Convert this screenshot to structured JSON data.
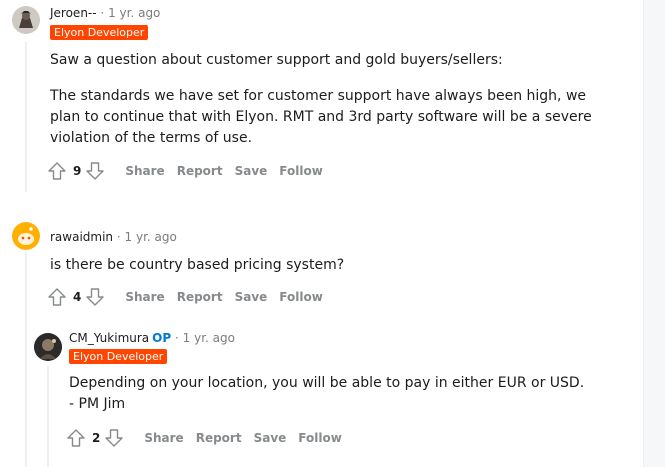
{
  "comments": [
    {
      "author": "Jeroen--",
      "time": "1 yr. ago",
      "flair": "Elyon Developer",
      "paragraphs": [
        "Saw a question about customer support and gold buyers/sellers:",
        "The standards we have set for customer support have always been high, we plan to continue that with Elyon. RMT and 3rd party software will be a severe violation of the terms of use."
      ],
      "score": "9",
      "actions": [
        "Share",
        "Report",
        "Save",
        "Follow"
      ]
    },
    {
      "author": "rawaidmin",
      "time": "1 yr. ago",
      "paragraphs": [
        "is there be country based pricing system?"
      ],
      "score": "4",
      "actions": [
        "Share",
        "Report",
        "Save",
        "Follow"
      ]
    },
    {
      "author": "CM_Yukimura",
      "op_label": "OP",
      "time": "1 yr. ago",
      "flair": "Elyon Developer",
      "paragraphs": [
        "Depending on your location, you will be able to pay in either EUR or USD.",
        "- PM Jim"
      ],
      "score": "2",
      "actions": [
        "Share",
        "Report",
        "Save",
        "Follow"
      ]
    }
  ],
  "separator": "·",
  "colors": {
    "flair_bg": "#ff4500",
    "op": "#0079d3",
    "muted": "#7c7c7c",
    "action": "#878a8c"
  }
}
